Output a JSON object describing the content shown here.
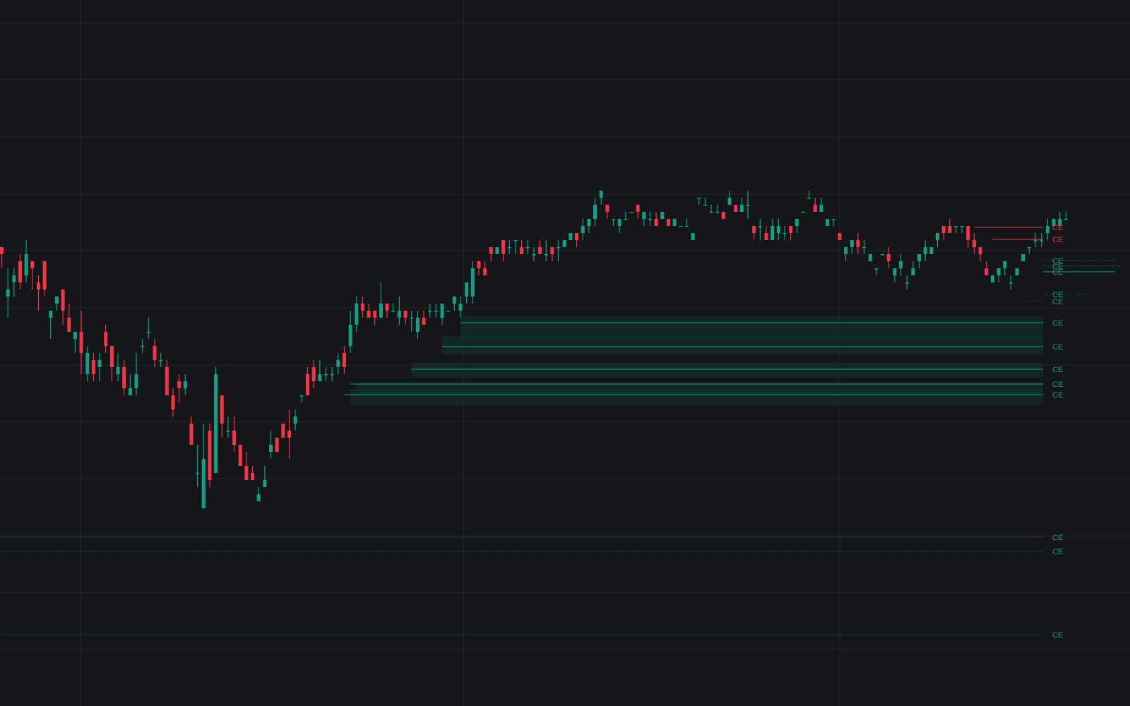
{
  "colors": {
    "background": "#151619",
    "grid": "#24262b",
    "bull": "#14a085",
    "bear": "#f23645",
    "zone_fill": "#11332d"
  },
  "chart_data": {
    "type": "candlestick",
    "grid": true,
    "title": "",
    "xlabel": "",
    "ylabel": "",
    "ylim": [
      0,
      100
    ],
    "note": "No axes or tick labels are printed; y values are read on a 0-100 relative scale (100 = top of chart area, 0 = bottom).",
    "candles": [
      [
        65,
        64,
        62,
        65
      ],
      [
        58,
        59,
        55,
        62
      ],
      [
        60,
        61,
        58,
        62
      ],
      [
        63,
        60,
        59,
        64
      ],
      [
        61,
        64,
        60,
        66
      ],
      [
        63,
        62,
        59,
        62
      ],
      [
        60,
        59,
        56,
        61
      ],
      [
        63,
        59,
        58,
        63
      ],
      [
        55,
        56,
        52,
        56
      ],
      [
        57,
        58,
        56,
        58
      ],
      [
        59,
        56,
        54,
        59
      ],
      [
        55,
        53,
        53,
        57
      ],
      [
        52,
        53,
        50,
        53
      ],
      [
        53,
        50,
        47,
        56
      ],
      [
        47,
        50,
        46,
        51
      ],
      [
        49,
        47,
        46,
        50
      ],
      [
        48,
        49,
        46,
        50
      ],
      [
        53,
        51,
        50,
        54
      ],
      [
        51,
        48,
        46,
        51
      ],
      [
        47,
        48,
        46,
        50
      ],
      [
        48,
        45,
        44,
        49
      ],
      [
        44,
        45,
        44,
        47
      ],
      [
        45,
        47,
        44,
        50
      ],
      [
        51,
        51,
        50,
        52
      ],
      [
        53,
        53,
        52,
        55
      ],
      [
        51,
        49,
        48,
        52
      ],
      [
        49,
        49,
        48,
        50
      ],
      [
        48,
        44,
        44,
        49
      ],
      [
        44,
        42,
        41,
        45
      ],
      [
        46,
        45,
        43,
        47
      ],
      [
        45,
        46,
        44,
        47
      ],
      [
        40,
        37,
        37,
        41
      ],
      [
        33,
        33,
        31,
        37
      ],
      [
        28,
        35,
        30,
        40
      ],
      [
        39,
        32,
        31,
        40
      ],
      [
        33,
        47,
        33,
        48
      ],
      [
        44,
        40,
        38,
        44
      ],
      [
        39,
        39,
        38,
        41
      ],
      [
        39,
        37,
        36,
        41
      ],
      [
        37,
        34,
        34,
        37
      ],
      [
        34,
        32,
        32,
        36
      ],
      [
        33,
        32,
        32,
        34
      ],
      [
        29,
        30,
        29,
        31
      ],
      [
        31,
        32,
        31,
        34
      ],
      [
        36,
        37,
        35,
        39
      ],
      [
        38,
        36,
        36,
        38
      ],
      [
        40,
        38,
        38,
        40
      ],
      [
        39,
        38,
        35,
        42
      ],
      [
        40,
        41,
        39,
        42
      ],
      [
        44,
        44,
        43,
        44
      ],
      [
        47,
        44,
        44,
        48
      ],
      [
        48,
        46,
        45,
        49
      ],
      [
        46,
        47,
        46,
        49
      ],
      [
        47,
        47,
        46,
        48
      ],
      [
        47,
        47,
        46,
        48
      ],
      [
        48,
        49,
        47,
        50
      ],
      [
        50,
        48,
        47,
        51
      ],
      [
        51,
        54,
        50,
        56
      ],
      [
        54,
        57,
        53,
        58
      ],
      [
        57,
        56,
        55,
        58
      ],
      [
        56,
        55,
        55,
        57
      ],
      [
        56,
        55,
        54,
        56
      ],
      [
        55,
        57,
        55,
        60
      ],
      [
        57,
        56,
        55,
        57
      ],
      [
        56,
        56,
        56,
        57
      ],
      [
        55,
        56,
        54,
        58
      ],
      [
        56,
        55,
        54,
        56
      ],
      [
        55,
        55,
        53,
        56
      ],
      [
        53,
        55,
        52,
        56
      ],
      [
        55,
        54,
        54,
        56
      ],
      [
        56,
        56,
        55,
        57
      ],
      [
        56,
        56,
        55,
        57
      ],
      [
        55,
        57,
        54,
        57
      ],
      [
        56,
        56,
        56,
        56
      ],
      [
        57,
        58,
        56,
        58
      ],
      [
        56,
        57,
        55,
        58
      ],
      [
        58,
        60,
        57,
        60
      ],
      [
        58,
        62,
        57,
        63
      ],
      [
        63,
        62,
        61,
        63
      ],
      [
        62,
        61,
        61,
        63
      ],
      [
        65,
        64,
        63,
        65
      ],
      [
        64,
        65,
        64,
        65
      ],
      [
        66,
        64,
        63,
        66
      ],
      [
        65,
        65,
        64,
        66
      ],
      [
        66,
        66,
        64,
        66
      ],
      [
        65,
        64,
        64,
        66
      ],
      [
        65,
        65,
        64,
        66
      ],
      [
        64,
        64,
        63,
        65
      ],
      [
        65,
        64,
        64,
        66
      ],
      [
        64,
        64,
        63,
        66
      ],
      [
        65,
        64,
        63,
        65
      ],
      [
        65,
        65,
        63,
        66
      ],
      [
        65,
        66,
        65,
        66
      ],
      [
        66,
        67,
        66,
        67
      ],
      [
        67,
        66,
        65,
        67
      ],
      [
        67,
        68,
        66,
        69
      ],
      [
        68,
        69,
        67,
        69
      ],
      [
        69,
        71,
        68,
        72
      ],
      [
        72,
        73,
        71,
        72
      ],
      [
        71,
        70,
        69,
        71
      ],
      [
        69,
        69,
        68,
        69
      ],
      [
        68,
        69,
        67,
        69
      ],
      [
        69,
        69,
        69,
        70
      ],
      [
        70,
        70,
        70,
        70
      ],
      [
        71,
        70,
        69,
        71
      ],
      [
        69,
        70,
        68,
        70
      ],
      [
        69,
        69,
        68,
        70
      ],
      [
        69,
        68,
        68,
        70
      ],
      [
        69,
        70,
        69,
        70
      ],
      [
        69,
        68,
        68,
        69
      ],
      [
        68,
        69,
        68,
        69
      ],
      [
        68,
        68,
        68,
        68
      ],
      [
        68,
        68,
        68,
        69
      ],
      [
        66,
        67,
        66,
        67
      ],
      [
        72,
        72,
        71,
        72
      ],
      [
        71,
        71,
        71,
        72
      ],
      [
        70,
        70,
        70,
        71
      ],
      [
        70,
        70,
        70,
        71
      ],
      [
        70,
        69,
        69,
        70
      ],
      [
        71,
        72,
        71,
        73
      ],
      [
        71,
        70,
        70,
        71
      ],
      [
        70,
        71,
        70,
        72
      ],
      [
        71,
        71,
        69,
        73
      ],
      [
        68,
        67,
        66,
        68
      ],
      [
        68,
        68,
        66,
        69
      ],
      [
        67,
        66,
        66,
        68
      ],
      [
        66,
        68,
        66,
        69
      ],
      [
        67,
        68,
        66,
        69
      ],
      [
        67,
        67,
        66,
        68
      ],
      [
        68,
        67,
        66,
        68
      ],
      [
        68,
        69,
        67,
        69
      ],
      [
        70,
        70,
        70,
        70
      ],
      [
        72,
        72,
        72,
        73
      ],
      [
        71,
        70,
        70,
        72
      ],
      [
        70,
        71,
        70,
        72
      ],
      [
        68,
        69,
        68,
        69
      ],
      [
        69,
        69,
        68,
        69
      ],
      [
        67,
        66,
        66,
        67
      ],
      [
        64,
        65,
        63,
        65
      ],
      [
        65,
        66,
        64,
        66
      ],
      [
        66,
        65,
        64,
        67
      ],
      [
        65,
        65,
        64,
        66
      ],
      [
        63,
        64,
        63,
        64
      ],
      [
        62,
        62,
        61,
        62
      ],
      [
        64,
        64,
        64,
        64
      ],
      [
        64,
        63,
        62,
        65
      ],
      [
        61,
        62,
        60,
        62
      ],
      [
        62,
        63,
        61,
        64
      ],
      [
        60,
        60,
        59,
        61
      ],
      [
        61,
        62,
        61,
        63
      ],
      [
        63,
        64,
        62,
        64
      ],
      [
        64,
        65,
        63,
        66
      ],
      [
        64,
        65,
        64,
        65
      ],
      [
        66,
        67,
        65,
        67
      ],
      [
        68,
        67,
        66,
        68
      ],
      [
        68,
        67,
        67,
        69
      ],
      [
        68,
        68,
        67,
        68
      ],
      [
        68,
        68,
        67,
        68
      ],
      [
        68,
        66,
        65,
        68
      ],
      [
        66,
        65,
        64,
        67
      ],
      [
        65,
        64,
        63,
        65
      ],
      [
        62,
        61,
        61,
        63
      ],
      [
        60,
        61,
        60,
        61
      ],
      [
        61,
        62,
        60,
        62
      ],
      [
        62,
        63,
        61,
        63
      ],
      [
        60,
        60,
        59,
        61
      ],
      [
        61,
        62,
        61,
        62
      ],
      [
        63,
        64,
        63,
        64
      ],
      [
        65,
        65,
        64,
        65
      ],
      [
        66,
        66,
        65,
        67
      ],
      [
        66,
        66,
        65,
        67
      ],
      [
        67,
        68,
        66,
        69
      ],
      [
        68,
        69,
        68,
        69
      ],
      [
        68,
        69,
        68,
        70
      ],
      [
        69,
        69,
        69,
        70
      ]
    ],
    "levels": [
      {
        "label": "CE",
        "value": 67.8,
        "style": "solid",
        "color": "bear",
        "start": 159
      },
      {
        "label": "CE",
        "value": 66.1,
        "style": "solid",
        "color": "bear",
        "start": 162
      },
      {
        "label": "CE",
        "value": 63.1,
        "style": "dotted",
        "color": "bull",
        "start": 182
      },
      {
        "label": "CE",
        "value": 62.3,
        "style": "dotted",
        "color": "bull",
        "start": 183
      },
      {
        "label": "CE",
        "value": 61.5,
        "style": "solid",
        "color": "bull",
        "start": 182
      },
      {
        "label": "CE",
        "value": 58.3,
        "style": "dotted",
        "color": "bull",
        "start": 178
      },
      {
        "label": "CE",
        "value": 57.3,
        "style": "dotted",
        "color": "bull",
        "start": 168
      },
      {
        "label": "CE",
        "value": 54.3,
        "style": "solid",
        "color": "bull",
        "start": 75
      },
      {
        "label": "CE",
        "value": 50.9,
        "style": "solid",
        "color": "bull",
        "start": 72
      },
      {
        "label": "CE",
        "value": 47.7,
        "style": "solid",
        "color": "bull",
        "start": 67
      },
      {
        "label": "CE",
        "value": 45.6,
        "style": "solid",
        "color": "bull",
        "start": 57
      },
      {
        "label": "CE",
        "value": 44.1,
        "style": "solid",
        "color": "bull",
        "start": 56
      },
      {
        "label": "CE",
        "value": 23.9,
        "style": "dotted",
        "color": "bull",
        "start": 0
      },
      {
        "label": "CE",
        "value": 21.9,
        "style": "dotted",
        "color": "bull",
        "start": 0
      },
      {
        "label": "CE",
        "value": 10.1,
        "style": "dotted",
        "color": "bull",
        "start": 0
      }
    ],
    "zones": [
      {
        "top": 55.2,
        "bottom": 52.0,
        "start": 75
      },
      {
        "top": 52.4,
        "bottom": 49.8,
        "start": 72
      },
      {
        "top": 48.6,
        "bottom": 46.6,
        "start": 67
      },
      {
        "top": 45.9,
        "bottom": 44.2,
        "start": 58
      },
      {
        "top": 44.9,
        "bottom": 42.6,
        "start": 57
      }
    ]
  }
}
